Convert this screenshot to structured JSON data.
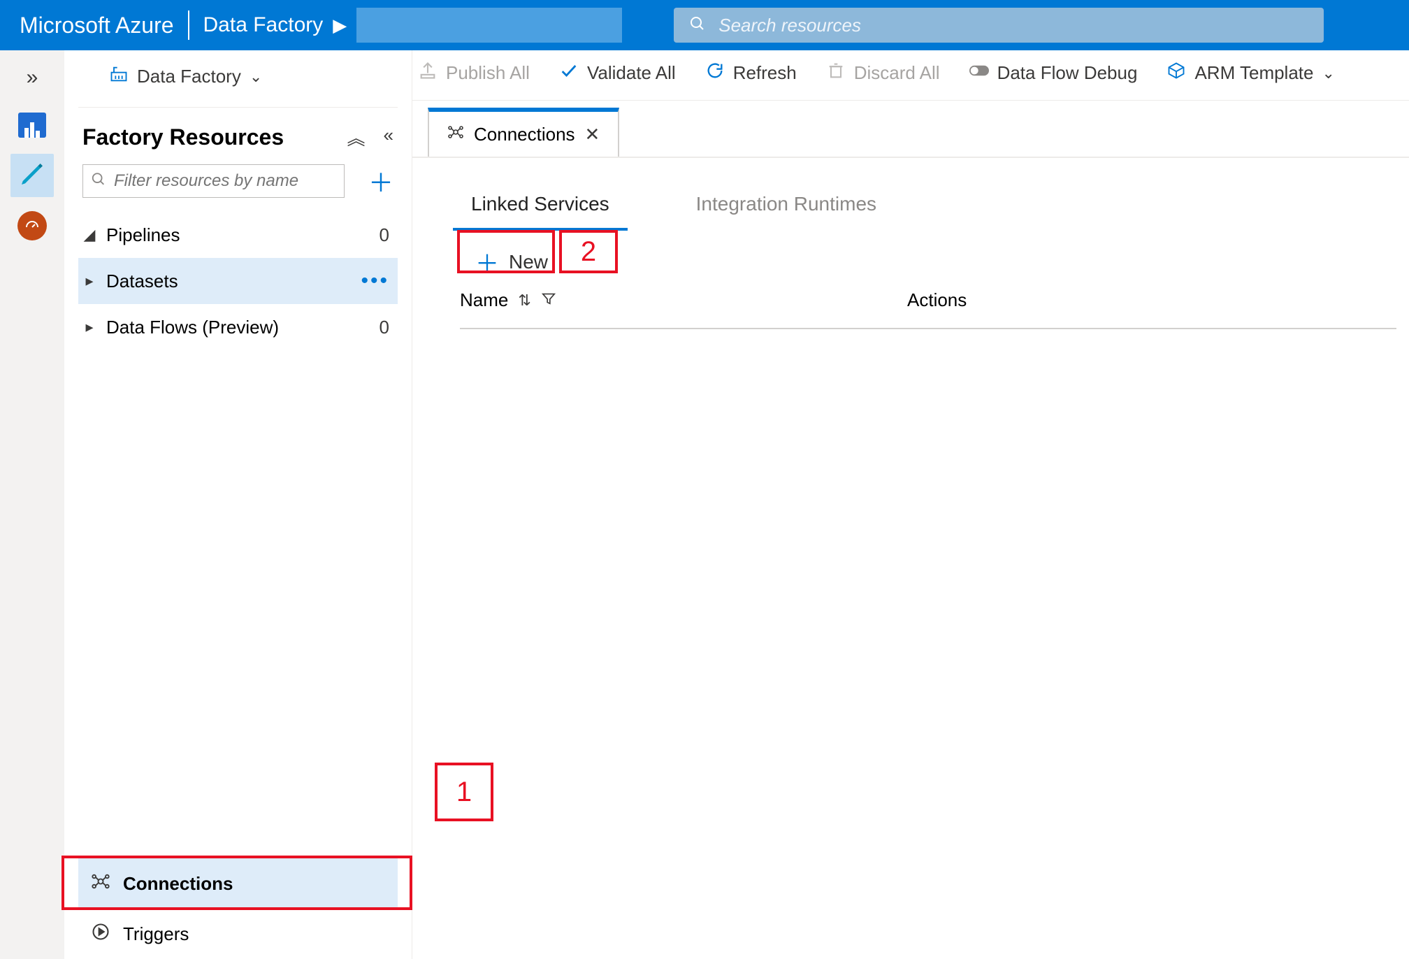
{
  "topbar": {
    "brand": "Microsoft Azure",
    "service": "Data Factory",
    "search_placeholder": "Search resources"
  },
  "toolbar": {
    "factory_dd": "Data Factory",
    "publish": "Publish All",
    "validate": "Validate All",
    "refresh": "Refresh",
    "discard": "Discard All",
    "dataflow": "Data Flow Debug",
    "arm": "ARM Template"
  },
  "panel": {
    "title": "Factory Resources",
    "filter_placeholder": "Filter resources by name",
    "tree": [
      {
        "label": "Pipelines",
        "count": "0",
        "expanded": true
      },
      {
        "label": "Datasets",
        "count": "",
        "expanded": false,
        "selected": true,
        "more": true
      },
      {
        "label": "Data Flows (Preview)",
        "count": "0",
        "expanded": false
      }
    ],
    "bottom": {
      "connections": "Connections",
      "triggers": "Triggers"
    }
  },
  "main": {
    "tab_label": "Connections",
    "subtabs": {
      "linked": "Linked Services",
      "runtimes": "Integration Runtimes"
    },
    "new_button": "New",
    "columns": {
      "name": "Name",
      "actions": "Actions"
    }
  },
  "callouts": {
    "one": "1",
    "two": "2"
  }
}
